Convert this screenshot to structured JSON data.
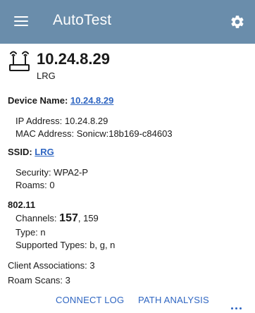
{
  "header": {
    "title": "AutoTest",
    "menu_icon": "hamburger-menu-icon",
    "settings_icon": "gear-icon",
    "bar_color": "#6a8dab"
  },
  "device": {
    "icon": "wifi-access-point-icon",
    "ip": "10.24.8.29",
    "ssid": "LRG"
  },
  "details": {
    "device_name_label": "Device Name:",
    "device_name_value": "10.24.8.29",
    "ip_address": "IP Address: 10.24.8.29",
    "mac_address": "MAC Address: Sonicw:18b169-c84603",
    "ssid_label": "SSID:",
    "ssid_value": "LRG",
    "security": "Security: WPA2-P",
    "roams": "Roams: 0",
    "section_80211": "802.11",
    "channels_label": "Channels:",
    "channels_primary": "157",
    "channels_secondary": ", 159",
    "type": "Type: n",
    "supported_types": "Supported Types: b, g, n",
    "client_associations": "Client Associations: 3",
    "roam_scans": "Roam Scans: 3"
  },
  "footer": {
    "connect_log": "CONNECT LOG",
    "path_analysis": "PATH ANALYSIS",
    "more_icon": "more-horizontal-icon",
    "link_color": "#2f66c2"
  }
}
